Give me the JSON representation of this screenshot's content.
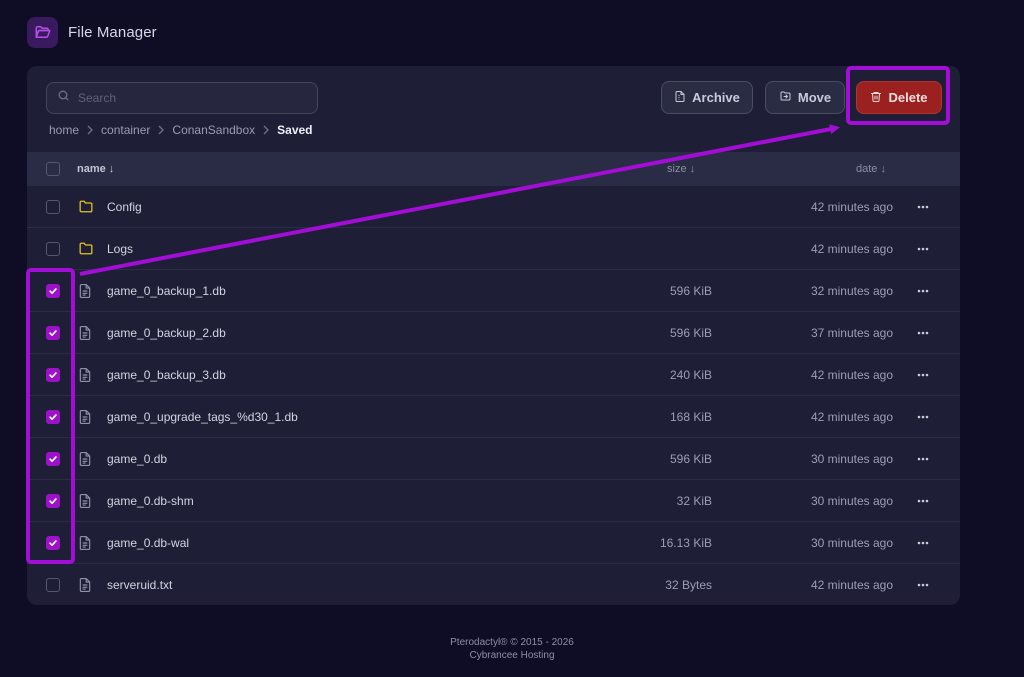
{
  "app": {
    "title": "File Manager"
  },
  "search": {
    "placeholder": "Search"
  },
  "breadcrumb": [
    "home",
    "container",
    "ConanSandbox",
    "Saved"
  ],
  "toolbar": {
    "archive_label": "Archive",
    "move_label": "Move",
    "delete_label": "Delete"
  },
  "table": {
    "headers": {
      "name": "name ↓",
      "size": "size ↓",
      "date": "date ↓"
    },
    "rows": [
      {
        "type": "folder",
        "name": "Config",
        "size": "",
        "date": "42 minutes ago",
        "checked": false
      },
      {
        "type": "folder",
        "name": "Logs",
        "size": "",
        "date": "42 minutes ago",
        "checked": false
      },
      {
        "type": "file",
        "name": "game_0_backup_1.db",
        "size": "596 KiB",
        "date": "32 minutes ago",
        "checked": true
      },
      {
        "type": "file",
        "name": "game_0_backup_2.db",
        "size": "596 KiB",
        "date": "37 minutes ago",
        "checked": true
      },
      {
        "type": "file",
        "name": "game_0_backup_3.db",
        "size": "240 KiB",
        "date": "42 minutes ago",
        "checked": true
      },
      {
        "type": "file",
        "name": "game_0_upgrade_tags_%d30_1.db",
        "size": "168 KiB",
        "date": "42 minutes ago",
        "checked": true
      },
      {
        "type": "file",
        "name": "game_0.db",
        "size": "596 KiB",
        "date": "30 minutes ago",
        "checked": true
      },
      {
        "type": "file",
        "name": "game_0.db-shm",
        "size": "32 KiB",
        "date": "30 minutes ago",
        "checked": true
      },
      {
        "type": "file",
        "name": "game_0.db-wal",
        "size": "16.13 KiB",
        "date": "30 minutes ago",
        "checked": true
      },
      {
        "type": "file",
        "name": "serveruid.txt",
        "size": "32 Bytes",
        "date": "42 minutes ago",
        "checked": false
      }
    ]
  },
  "footer": {
    "line1": "Pterodactyl® © 2015 - 2026",
    "line2": "Cybrancee Hosting"
  },
  "colors": {
    "background": "#0f0d26",
    "panel": "#1e1f36",
    "accent_purple": "#9d11c9",
    "delete_red": "#9b2121",
    "folder_yellow": "#e8c21c"
  },
  "icons": {
    "logo": "folder-open-icon",
    "search": "search-icon",
    "archive": "archive-file-icon",
    "move": "move-folder-icon",
    "delete": "trash-icon",
    "folder": "folder-icon",
    "file": "file-text-icon",
    "more": "ellipsis-icon",
    "check": "check-icon"
  }
}
